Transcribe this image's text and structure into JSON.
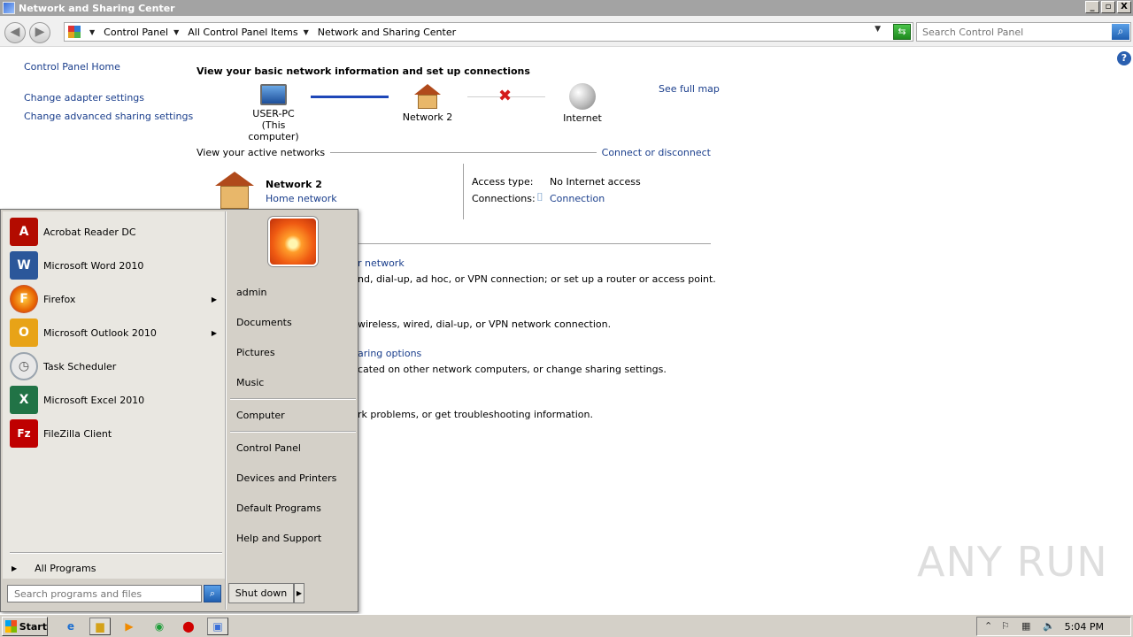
{
  "window": {
    "title": "Network and Sharing Center",
    "controls": [
      "_",
      "▫",
      "X"
    ]
  },
  "address": {
    "crumbs": [
      "Control Panel",
      "All Control Panel Items",
      "Network and Sharing Center"
    ],
    "search_placeholder": "Search Control Panel"
  },
  "leftnav": {
    "home": "Control Panel Home",
    "adapter": "Change adapter settings",
    "advanced": "Change advanced sharing settings"
  },
  "main": {
    "heading": "View your basic network information and set up connections",
    "see_full_map": "See full map",
    "nodes": {
      "computer": "USER-PC",
      "computer_sub": "(This computer)",
      "network": "Network  2",
      "internet": "Internet"
    },
    "active_networks_label": "View your active networks",
    "connect_disconnect": "Connect or disconnect",
    "network_name": "Network  2",
    "network_type": "Home network",
    "access_type_label": "Access type:",
    "access_type_value": "No Internet access",
    "connections_label": "Connections:",
    "connections_value": "Connection",
    "partial": {
      "line1_link": "r network",
      "line1_text": "nd, dial-up, ad hoc, or VPN connection; or set up a router or access point.",
      "line2_text": "wireless, wired, dial-up, or VPN network connection.",
      "line3_link": "aring options",
      "line3_text": "cated on other network computers, or change sharing settings.",
      "line4_text": "rk problems, or get troubleshooting information."
    }
  },
  "startmenu": {
    "programs": [
      {
        "label": "Acrobat Reader DC",
        "icon": "acrobat-icon",
        "color": "#b30b00",
        "glyph": "A",
        "submenu": false
      },
      {
        "label": "Microsoft Word 2010",
        "icon": "word-icon",
        "color": "#2b579a",
        "glyph": "W",
        "submenu": false
      },
      {
        "label": "Firefox",
        "icon": "firefox-icon",
        "color": "#e66000",
        "glyph": "F",
        "submenu": true
      },
      {
        "label": "Microsoft Outlook 2010",
        "icon": "outlook-icon",
        "color": "#e8a317",
        "glyph": "O",
        "submenu": true
      },
      {
        "label": "Task Scheduler",
        "icon": "clock-icon",
        "color": "#9aa4ae",
        "glyph": "◷",
        "submenu": false
      },
      {
        "label": "Microsoft Excel 2010",
        "icon": "excel-icon",
        "color": "#217346",
        "glyph": "X",
        "submenu": false
      },
      {
        "label": "FileZilla Client",
        "icon": "filezilla-icon",
        "color": "#bf0000",
        "glyph": "Fz",
        "submenu": false
      }
    ],
    "all_programs": "All Programs",
    "search_placeholder": "Search programs and files",
    "right_items": {
      "user": "admin",
      "documents": "Documents",
      "pictures": "Pictures",
      "music": "Music",
      "computer": "Computer",
      "control_panel": "Control Panel",
      "devices": "Devices and Printers",
      "defaults": "Default Programs",
      "help": "Help and Support"
    },
    "shutdown": "Shut down"
  },
  "taskbar": {
    "start": "Start",
    "clock": "5:04 PM"
  },
  "watermark": "ANY RUN"
}
